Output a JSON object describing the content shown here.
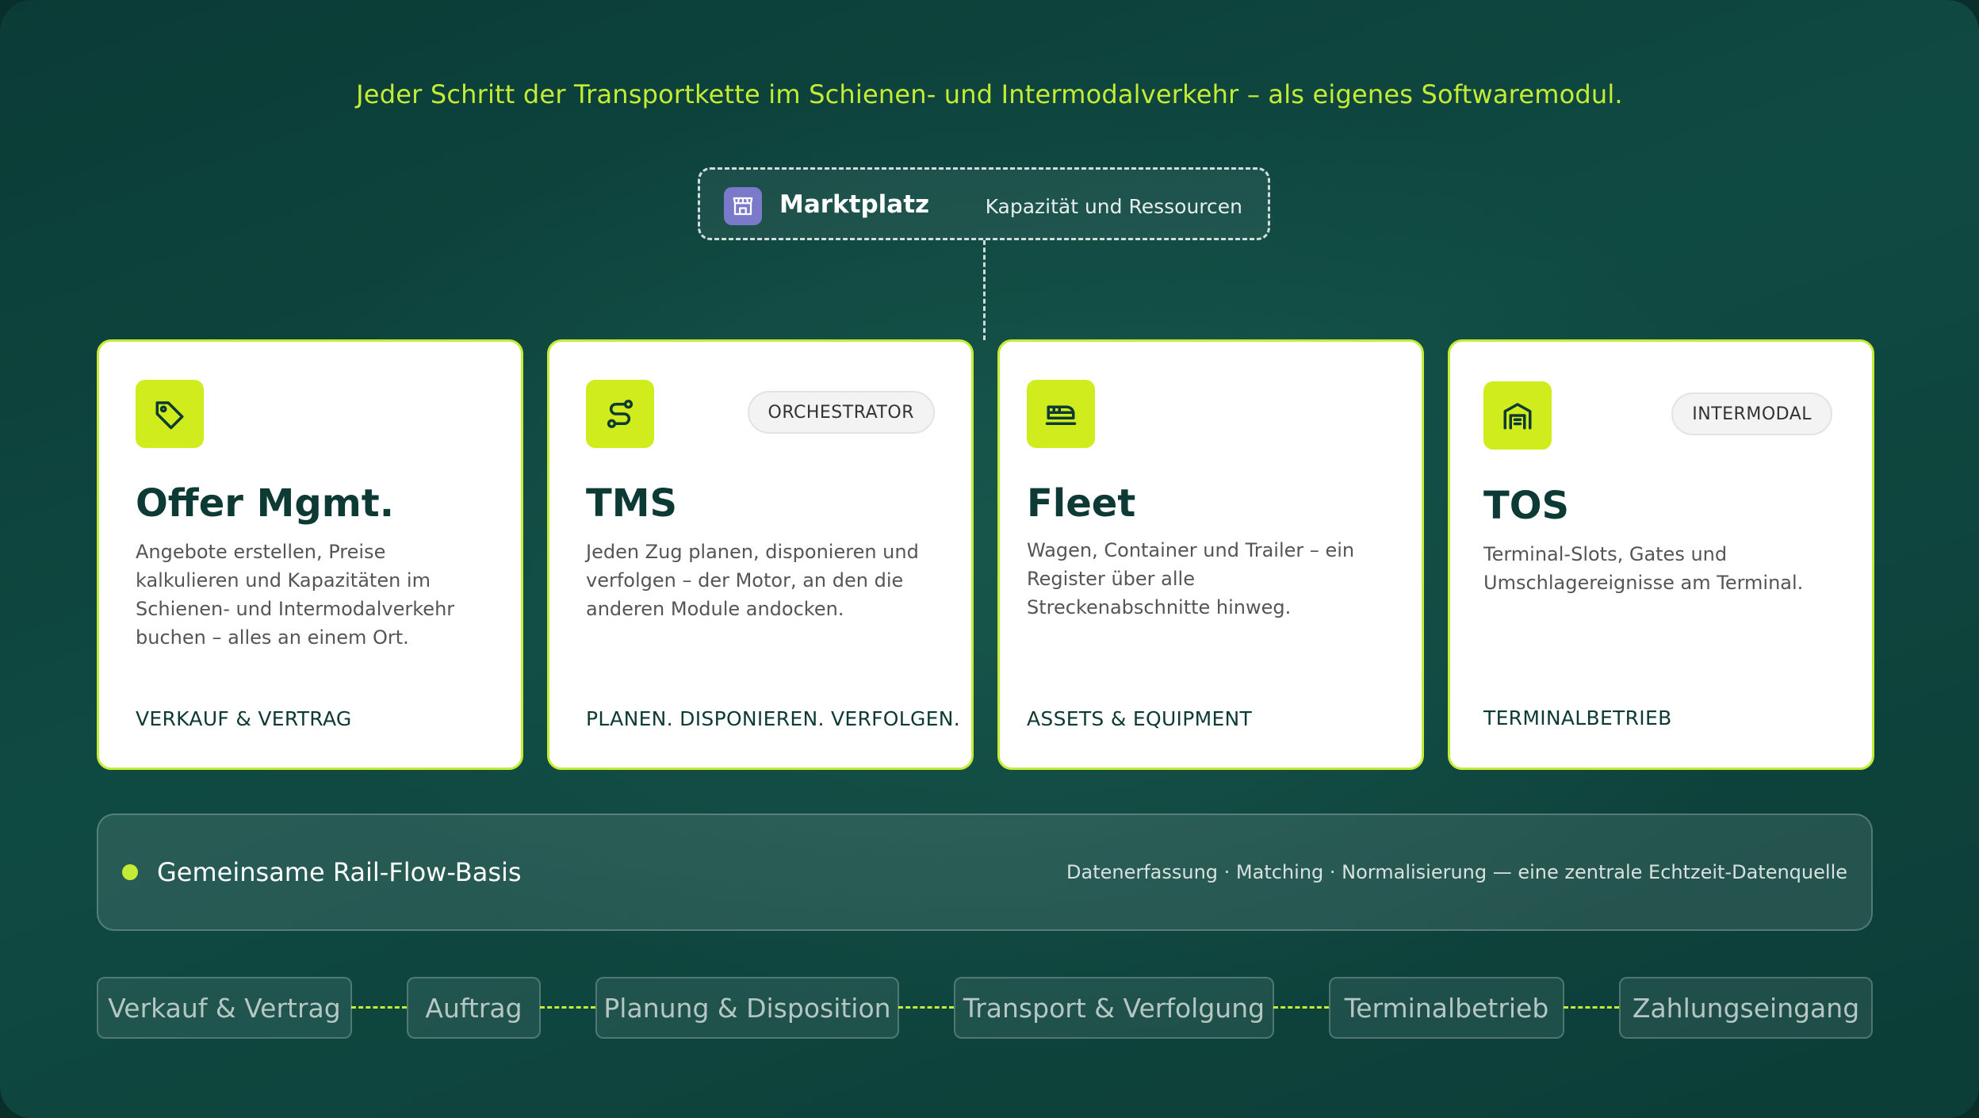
{
  "headline": "Jeder Schritt der Transportkette im Schienen- und Intermodalverkehr – als eigenes Softwaremodul.",
  "marketplace": {
    "title": "Marktplatz",
    "subtitle": "Kapazität und Ressourcen",
    "icon": "storefront-icon",
    "icon_color": "#7b79c9"
  },
  "modules": [
    {
      "title": "Offer Mgmt.",
      "icon": "tag-icon",
      "badge": "",
      "description": "Angebote erstellen, Preise kalkulieren und Kapazitäten im Schienen- und Intermodalverkehr buchen – alles an einem Ort.",
      "tag": "VERKAUF & VERTRAG"
    },
    {
      "title": "TMS",
      "icon": "route-icon",
      "badge": "ORCHESTRATOR",
      "description": "Jeden Zug planen, disponieren und verfolgen – der Motor, an den die anderen Module andocken.",
      "tag": "PLANEN. DISPONIEREN. VERFOLGEN."
    },
    {
      "title": "Fleet",
      "icon": "train-icon",
      "badge": "",
      "description": "Wagen, Container und Trailer – ein Register über alle Streckenabschnitte hinweg.",
      "tag": "ASSETS & EQUIPMENT"
    },
    {
      "title": "TOS",
      "icon": "warehouse-icon",
      "badge": "INTERMODAL",
      "description": "Terminal-Slots, Gates und Umschlagereignisse am Terminal.",
      "tag": "TERMINALBETRIEB"
    }
  ],
  "basis": {
    "title": "Gemeinsame Rail-Flow-Basis",
    "subtitle": "Datenerfassung · Matching · Normalisierung — eine zentrale Echtzeit-Datenquelle"
  },
  "steps": [
    "Verkauf & Vertrag",
    "Auftrag",
    "Planung & Disposition",
    "Transport & Verfolgung",
    "Terminalbetrieb",
    "Zahlungseingang"
  ],
  "colors": {
    "accent": "#c4ec35",
    "icon_tile": "#d0ec1c",
    "dark_text": "#0d3a35",
    "background": "#0b3b36"
  }
}
